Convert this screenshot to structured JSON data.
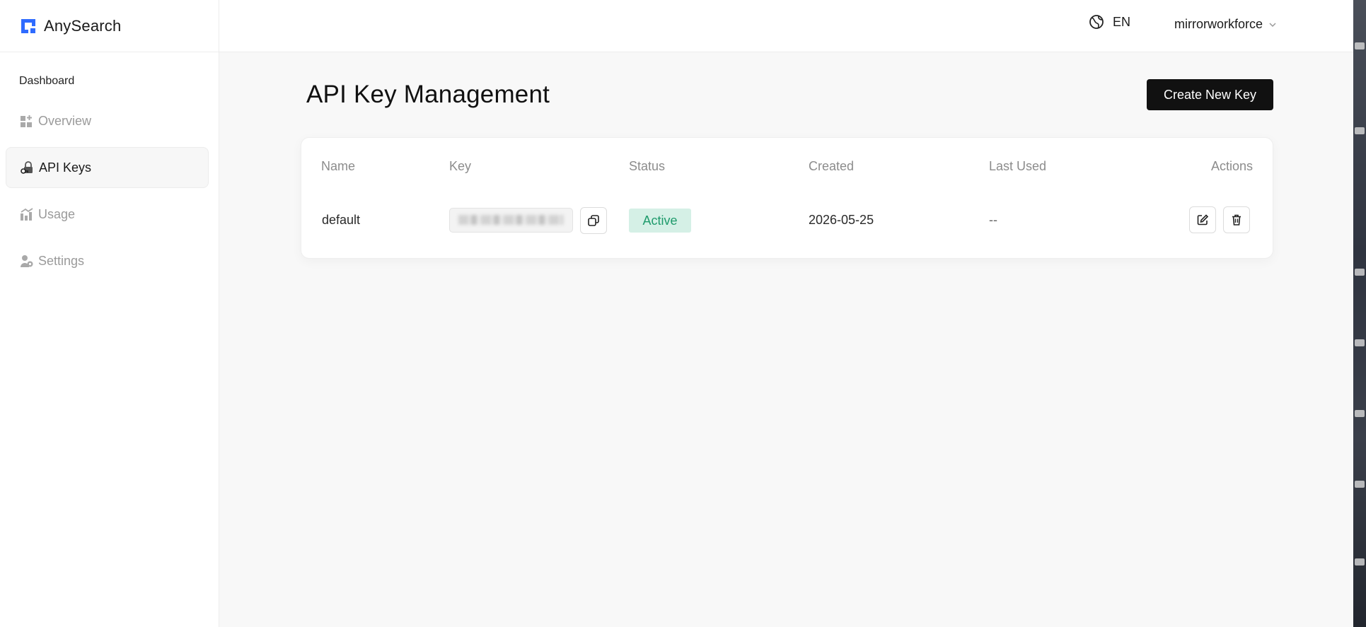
{
  "app": {
    "brand_name": "AnySearch"
  },
  "header": {
    "language": "EN",
    "username": "mirrorworkforce"
  },
  "sidebar": {
    "section_label": "Dashboard",
    "items": [
      {
        "label": "Overview",
        "icon": "overview-icon",
        "active": false
      },
      {
        "label": "API Keys",
        "icon": "key-icon",
        "active": true
      },
      {
        "label": "Usage",
        "icon": "usage-chart-icon",
        "active": false
      },
      {
        "label": "Settings",
        "icon": "user-settings-icon",
        "active": false
      }
    ]
  },
  "main": {
    "title": "API Key Management",
    "create_button": "Create New Key",
    "table": {
      "columns": [
        "Name",
        "Key",
        "Status",
        "Created",
        "Last Used",
        "Actions"
      ],
      "rows": [
        {
          "name": "default",
          "status": "Active",
          "created": "2026-05-25",
          "last_used": "--"
        }
      ]
    }
  },
  "colors": {
    "accent": "#2f6bff",
    "primary_button": "#111111",
    "status_active_bg": "#d5f0e6",
    "status_active_text": "#1f9b6c",
    "page_background": "#f8f8f8"
  }
}
